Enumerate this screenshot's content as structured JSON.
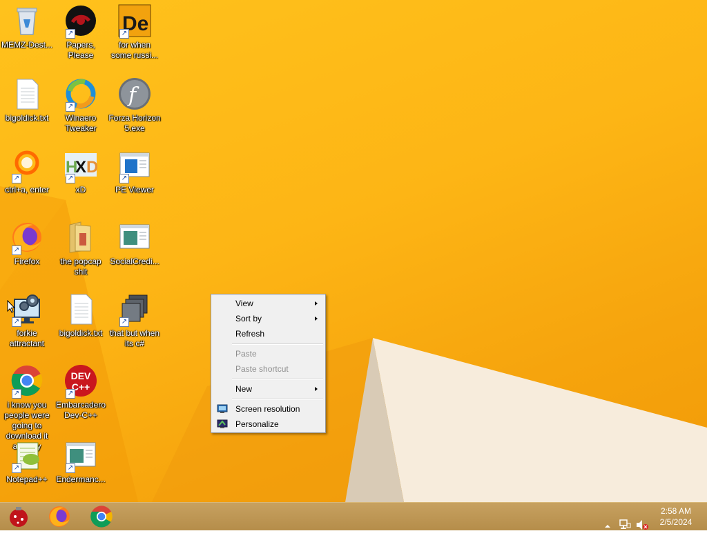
{
  "desktop": {
    "icons": [
      {
        "label": "MEMZ-Dest...",
        "icon": "recycle-bin-icon"
      },
      {
        "label": "Papers, Please",
        "icon": "papers-please-icon"
      },
      {
        "label": "for when some russi...",
        "icon": "de-app-icon"
      },
      {
        "label": "bigoldick.txt",
        "icon": "text-file-icon"
      },
      {
        "label": "Winaero Tweaker",
        "icon": "winaero-icon"
      },
      {
        "label": "Forza Horizon 5.exe",
        "icon": "flash-icon"
      },
      {
        "label": "ctrl+a, enter",
        "icon": "orange-ring-icon"
      },
      {
        "label": "xD",
        "icon": "hxd-icon"
      },
      {
        "label": "PE Viewer",
        "icon": "window-app-icon"
      },
      {
        "label": "Firefox",
        "icon": "firefox-icon"
      },
      {
        "label": "the popcap shit",
        "icon": "folder-icon"
      },
      {
        "label": "SocialCredi...",
        "icon": "window-app-icon"
      },
      {
        "label": "forkie attractant",
        "icon": "settings-monitor-icon"
      },
      {
        "label": "bigoldick.txt",
        "icon": "text-file-icon"
      },
      {
        "label": "that but when its c#",
        "icon": "stacked-windows-icon"
      },
      {
        "label": "i know you people were going to download it anyway",
        "icon": "chrome-icon"
      },
      {
        "label": "Embarcadero Dev-C++",
        "icon": "devcpp-icon"
      },
      {
        "label": "Notepad++",
        "icon": "notepadpp-icon"
      },
      {
        "label": "Endermanc...",
        "icon": "window-app-icon"
      }
    ]
  },
  "context_menu": {
    "items": {
      "view": "View",
      "sort_by": "Sort by",
      "refresh": "Refresh",
      "paste": "Paste",
      "paste_shortcut": "Paste shortcut",
      "new": "New",
      "screen_resolution": "Screen resolution",
      "personalize": "Personalize"
    }
  },
  "taskbar": {
    "apps": [
      "memz-icon",
      "firefox-icon",
      "chrome-icon"
    ],
    "clock": {
      "time": "2:58 AM",
      "date": "2/5/2024"
    }
  },
  "colors": {
    "wallpaper": "#fdb515",
    "taskbar": "#b58d4a",
    "menu_bg": "#f0f0f0",
    "disabled_text": "#8d8d8d"
  }
}
